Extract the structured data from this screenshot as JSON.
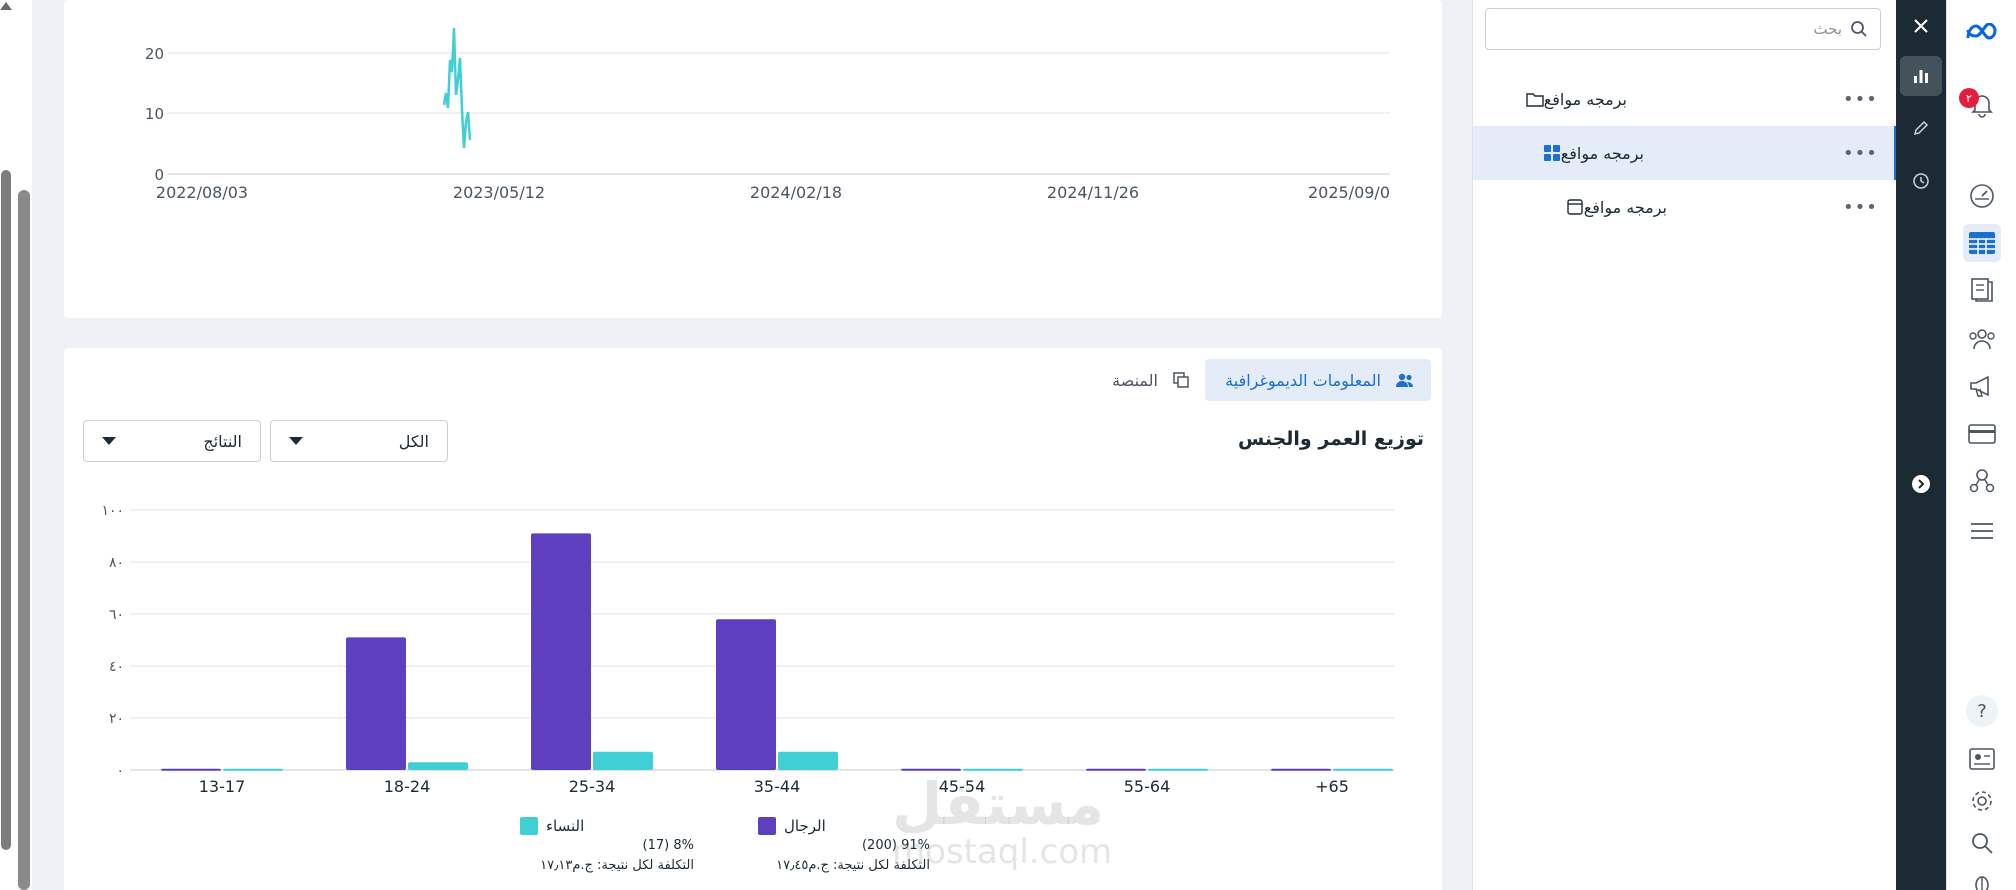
{
  "top_chart": {
    "y_ticks": [
      "0",
      "10",
      "20"
    ],
    "x_ticks": [
      "2022/08/03",
      "2023/05/12",
      "2024/02/18",
      "2024/11/26",
      "2025/09/0"
    ]
  },
  "tabs": {
    "demographics": "المعلومات الديموغرافية",
    "platform": "المنصة"
  },
  "section_title": "توزيع العمر والجنس",
  "dropdowns": {
    "all": "الكل",
    "results": "النتائج"
  },
  "chart_data": {
    "type": "bar",
    "categories": [
      "13-17",
      "18-24",
      "25-34",
      "35-44",
      "45-54",
      "55-64",
      "+65"
    ],
    "y_ticks": [
      "٠",
      "٢٠",
      "٤٠",
      "٦٠",
      "٨٠",
      "١٠٠"
    ],
    "ylim": [
      0,
      100
    ],
    "series": [
      {
        "name": "الرجال",
        "color": "#5e3fbf",
        "values": [
          0.5,
          51,
          91,
          58,
          0.5,
          0.5,
          0.5
        ]
      },
      {
        "name": "النساء",
        "color": "#3fcfd4",
        "values": [
          0.5,
          3,
          7,
          7,
          0.5,
          0.5,
          0.5
        ]
      }
    ]
  },
  "legend": {
    "men": {
      "name": "الرجال",
      "pct": "91% (200)",
      "cost": "التكلفة لكل نتيجة: ج.م١٧٫٤٥"
    },
    "women": {
      "name": "النساء",
      "pct": "8% (17)",
      "cost": "التكلفة لكل نتيجة: ج.م١٧٫١٣"
    }
  },
  "watermark": {
    "arabic": "مستقل",
    "latin": "mostaql.com"
  },
  "search": {
    "placeholder": "بحث"
  },
  "tree": [
    {
      "label": "برمجه موافع",
      "icon": "folder-icon"
    },
    {
      "label": "برمجه موافع",
      "icon": "grid-icon"
    },
    {
      "label": "برمجه موافع",
      "icon": "window-icon"
    }
  ],
  "notifications": {
    "count": "٢"
  },
  "colors": {
    "accent": "#1d6fd1",
    "men": "#5e3fbf",
    "women": "#3fcfd4",
    "line": "#3fcfd4"
  }
}
